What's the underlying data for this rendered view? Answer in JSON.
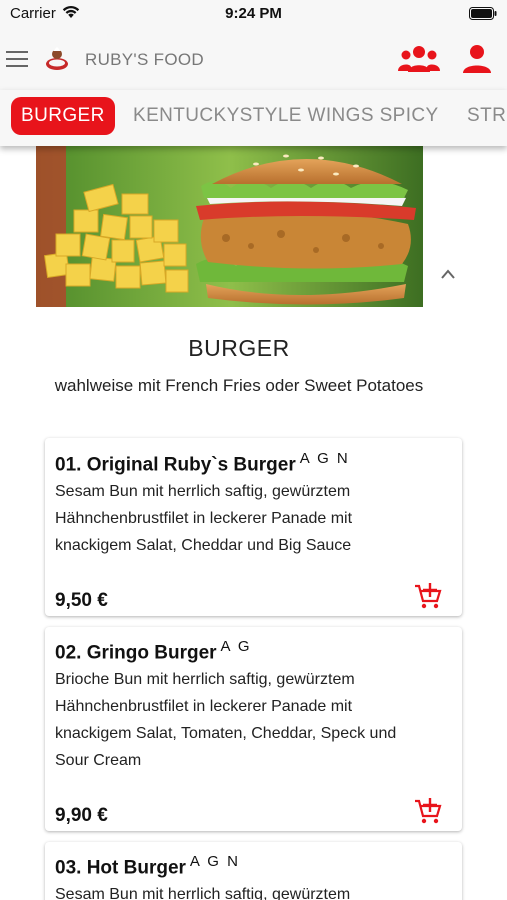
{
  "status_bar": {
    "carrier": "Carrier",
    "time": "9:24 PM"
  },
  "header": {
    "brand": "RUBY'S FOOD"
  },
  "colors": {
    "accent": "#e8141b",
    "background": "#f7f7f7"
  },
  "icons": [
    "menu-icon",
    "logo",
    "group-icon",
    "person-icon",
    "chevron-up-icon",
    "add-to-cart-icon"
  ],
  "tabs": [
    {
      "label": "BURGER",
      "active": true
    },
    {
      "label": "KENTUCKYSTYLE WINGS SPICY",
      "active": false
    },
    {
      "label": "STR",
      "active": false
    }
  ],
  "category": {
    "title": "BURGER",
    "subtitle": "wahlweise mit French Fries oder Sweet Potatoes"
  },
  "items": [
    {
      "name": "01. Original Ruby`s Burger",
      "allergens": "A G N",
      "description": [
        "Sesam Bun mit herrlich saftig, gewürztem",
        "Hähnchenbrustfilet in leckerer Panade mit",
        "knackigem Salat, Cheddar und Big Sauce"
      ],
      "price": "9,50 €"
    },
    {
      "name": "02. Gringo Burger",
      "allergens": "A G",
      "description": [
        "Brioche Bun mit herrlich saftig, gewürztem",
        "Hähnchenbrustfilet in leckerer Panade mit",
        "knackigem Salat, Tomaten, Cheddar, Speck und",
        "Sour Cream"
      ],
      "price": "9,90 €"
    },
    {
      "name": "03. Hot Burger",
      "allergens": "A G N",
      "description": [
        "Sesam Bun mit herrlich saftig, gewürztem"
      ],
      "price": ""
    }
  ]
}
